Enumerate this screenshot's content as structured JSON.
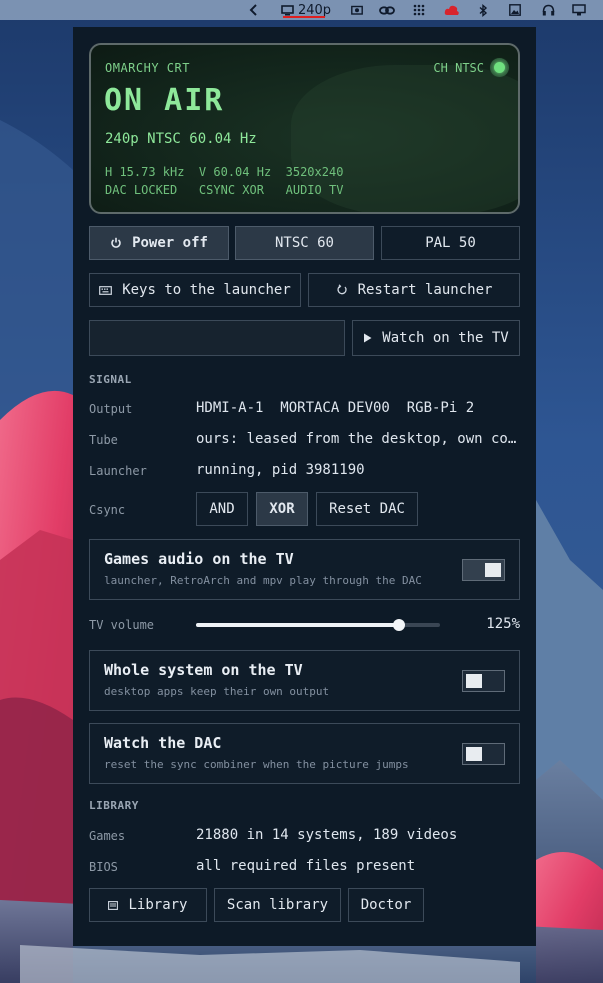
{
  "topbar": {
    "resolution": "240p",
    "icons": [
      "chevron-left-icon",
      "monitor-icon",
      "camera-icon",
      "link-icon",
      "dots-grid-icon",
      "cloud-alert-icon",
      "bluetooth-icon",
      "image-icon",
      "headphones-icon",
      "display-icon"
    ],
    "accent": "#e01f1f"
  },
  "crt": {
    "brand": "OMARCHY CRT",
    "channel": "CH NTSC",
    "status": "ON AIR",
    "mode": "240p NTSC 60.04 Hz",
    "line1": "H 15.73 kHz  V 60.04 Hz  3520x240",
    "line2": "DAC LOCKED   CSYNC XOR   AUDIO TV",
    "phosphor_color": "#8ee89a"
  },
  "controls": {
    "power_off": "Power off",
    "ntsc": "NTSC 60",
    "pal": "PAL 50",
    "keys": "Keys to the launcher",
    "restart": "Restart launcher",
    "input_value": "",
    "watch": "Watch on the TV"
  },
  "signal": {
    "heading": "SIGNAL",
    "output_label": "Output",
    "output_value": "HDMI-A-1  MORTACA DEV00  RGB-Pi 2",
    "tube_label": "Tube",
    "tube_value": "ours: leased from the desktop, own co…",
    "launcher_label": "Launcher",
    "launcher_value": "running, pid 3981190",
    "csync_label": "Csync",
    "csync_and": "AND",
    "csync_xor": "XOR",
    "csync_selected": "XOR",
    "reset_dac": "Reset DAC"
  },
  "audio": {
    "title": "Games audio on the TV",
    "sub": "launcher, RetroArch and mpv play through the DAC",
    "enabled": true,
    "volume_label": "TV volume",
    "volume_value": "125%",
    "volume_fraction": 0.83
  },
  "whole_system": {
    "title": "Whole system on the TV",
    "sub": "desktop apps keep their own output",
    "enabled": false
  },
  "watch_dac": {
    "title": "Watch the DAC",
    "sub": "reset the sync combiner when the picture jumps",
    "enabled": false
  },
  "library": {
    "heading": "LIBRARY",
    "games_label": "Games",
    "games_value": "21880 in 14 systems, 189 videos",
    "bios_label": "BIOS",
    "bios_value": "all required files present",
    "library_button": "Library",
    "scan_button": "Scan library",
    "doctor_button": "Doctor"
  },
  "colors": {
    "panel_bg": "#0d1a27",
    "border": "#3c4a59",
    "mountain_pink": "#e8456e"
  }
}
